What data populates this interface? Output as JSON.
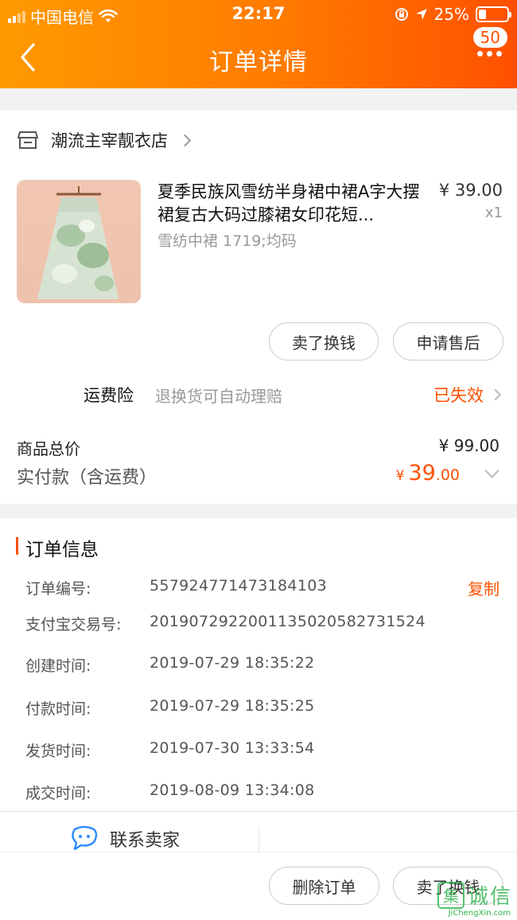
{
  "status_bar": {
    "carrier": "中国电信",
    "time": "22:17",
    "battery": "25%",
    "battery_level": 0.25,
    "icons": [
      "signal-icon",
      "wifi-icon",
      "orientation-lock-icon",
      "location-icon",
      "battery-icon"
    ]
  },
  "header": {
    "title": "订单详情",
    "message_badge": "50",
    "icons": [
      "back-icon",
      "more-icon"
    ]
  },
  "shop": {
    "name": "潮流主宰靓衣店",
    "icon": "store-icon"
  },
  "product": {
    "title": "夏季民族风雪纺半身裙中裙A字大摆裙复古大码过膝裙女印花短...",
    "spec": "雪纺中裙 1719;均码",
    "price": "¥ 39.00",
    "quantity": "x1",
    "actions": {
      "sell": "卖了换钱",
      "after_sale": "申请售后"
    }
  },
  "shipping_insurance": {
    "label": "运费险",
    "description": "退换货可自动理赔",
    "status": "已失效"
  },
  "totals": {
    "goods_total_label": "商品总价",
    "goods_total": "¥ 99.00",
    "paid_label": "实付款（含运费）",
    "paid_currency": "¥",
    "paid_int": "39",
    "paid_dec": ".00"
  },
  "order_info": {
    "title": "订单信息",
    "copy": "复制",
    "rows": [
      {
        "label": "订单编号:",
        "value": "557924771473184103"
      },
      {
        "label": "支付宝交易号:",
        "value": "2019072922001135020582731524"
      },
      {
        "label": "创建时间:",
        "value": "2019-07-29 18:35:22"
      },
      {
        "label": "付款时间:",
        "value": "2019-07-29 18:35:25"
      },
      {
        "label": "发货时间:",
        "value": "2019-07-30 13:33:54"
      },
      {
        "label": "成交时间:",
        "value": "2019-08-09 13:34:08"
      }
    ],
    "contact_seller": "联系卖家"
  },
  "bottom_bar": {
    "delete_order": "删除订单",
    "sell": "卖了换钱"
  },
  "watermark": {
    "text": "诚信",
    "sub": "JiChengXin.com"
  },
  "colors": {
    "brand": "#ff5000",
    "header_start": "#ff9a00",
    "header_end": "#ff5000",
    "watermark": "#2db34a"
  }
}
